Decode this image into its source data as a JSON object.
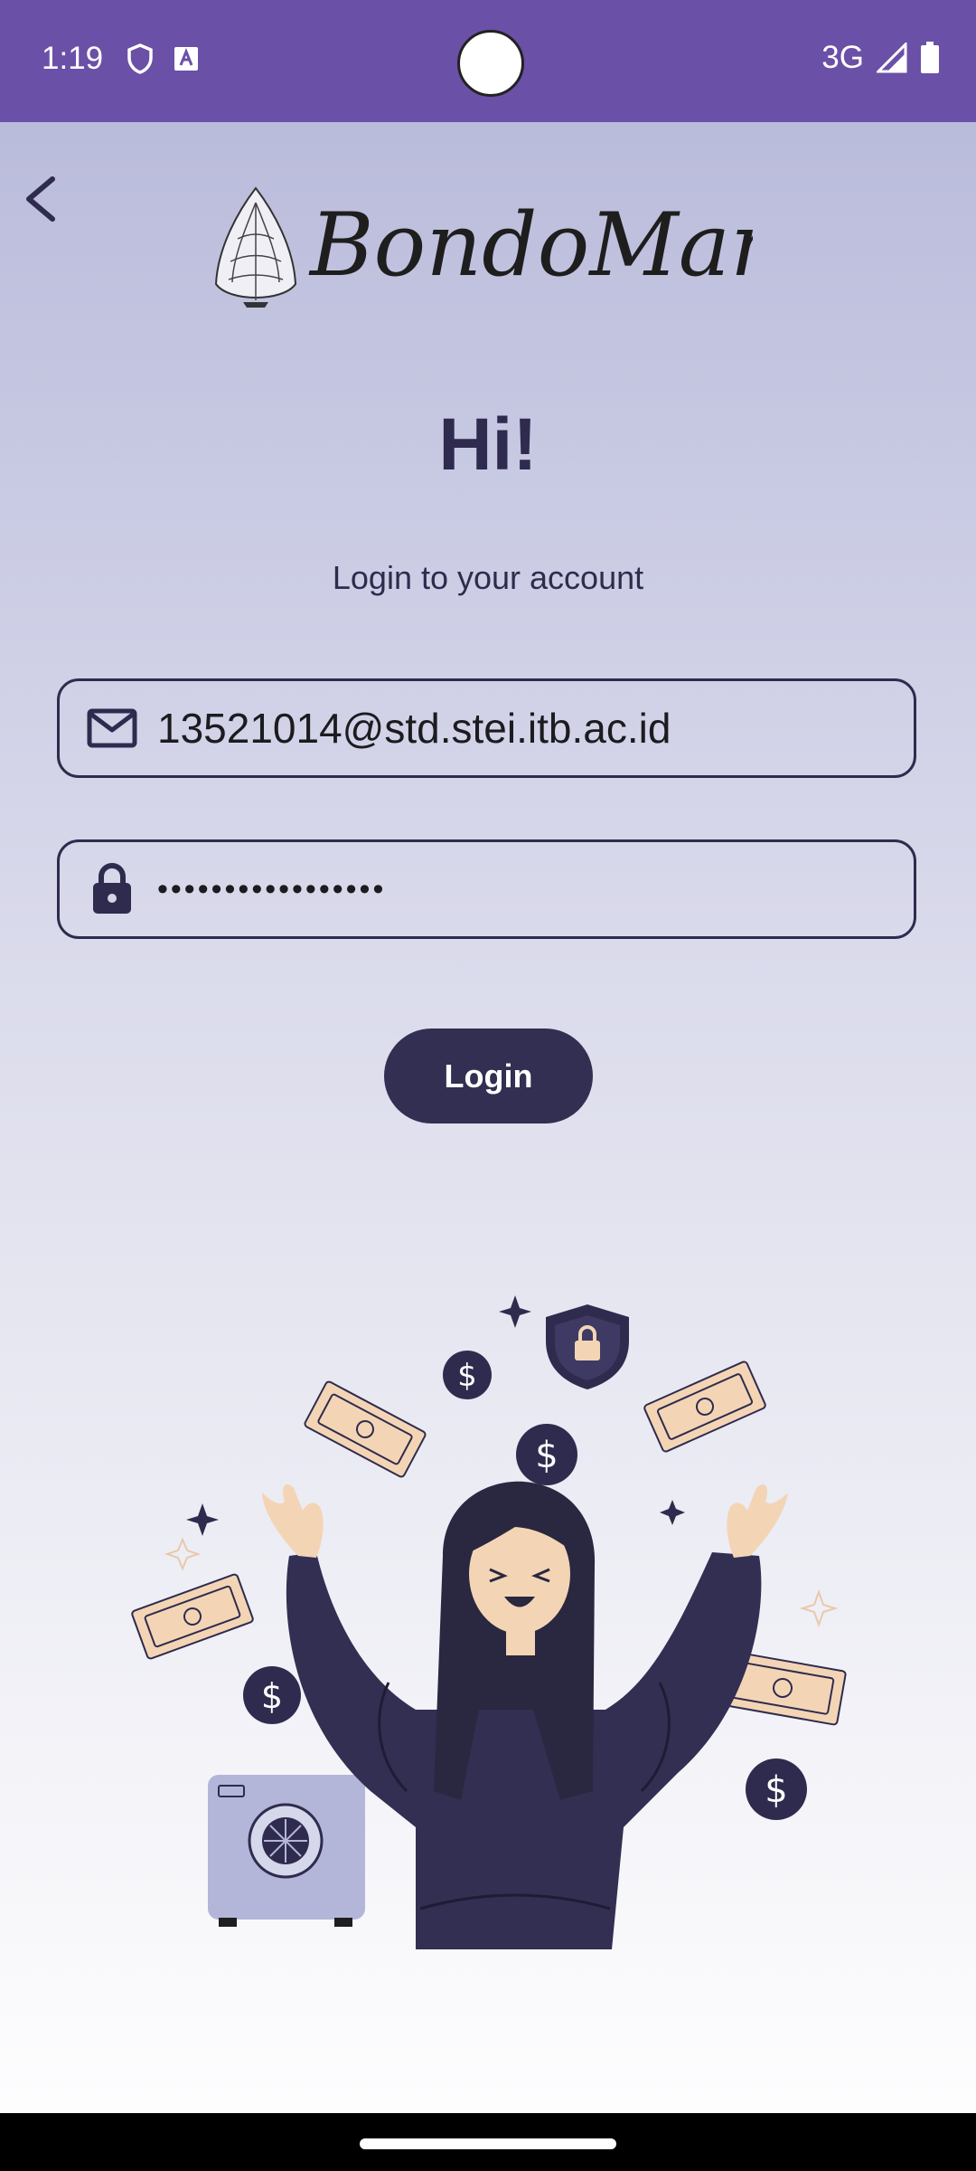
{
  "status_bar": {
    "time": "1:19",
    "network": "3G",
    "background": "#6a50a7"
  },
  "header": {
    "back_icon": "chevron-left-icon",
    "logo_text": "BondoMan"
  },
  "login": {
    "greeting": "Hi!",
    "subtitle": "Login to your account",
    "email_value": "13521014@std.stei.itb.ac.id",
    "email_icon": "mail-icon",
    "password_value": "•••••••••••••••••",
    "password_icon": "lock-icon",
    "login_label": "Login"
  },
  "colors": {
    "primary": "#322f52",
    "text": "#2f2b4e",
    "accent": "#6a50a7"
  }
}
